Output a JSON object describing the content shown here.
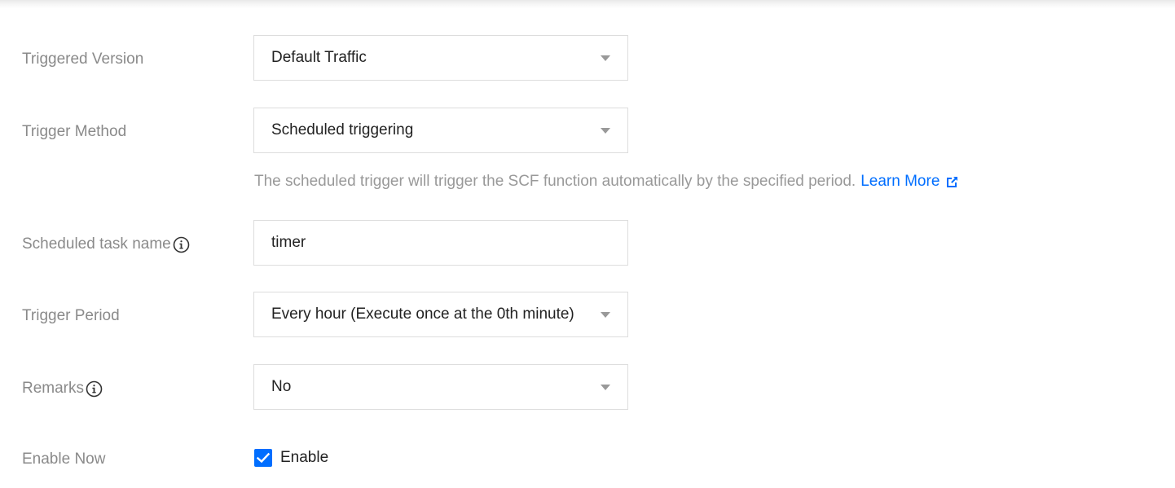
{
  "form": {
    "triggered_version": {
      "label": "Triggered Version",
      "value": "Default Traffic"
    },
    "trigger_method": {
      "label": "Trigger Method",
      "value": "Scheduled triggering",
      "hint": "The scheduled trigger will trigger the SCF function automatically by the specified period.",
      "learn_more": "Learn More"
    },
    "scheduled_task_name": {
      "label": "Scheduled task name",
      "value": "timer"
    },
    "trigger_period": {
      "label": "Trigger Period",
      "value": "Every hour (Execute once at the 0th minute)"
    },
    "remarks": {
      "label": "Remarks",
      "value": "No"
    },
    "enable_now": {
      "label": "Enable Now",
      "checkbox_label": "Enable",
      "checked": true
    }
  },
  "colors": {
    "accent": "#006eff",
    "label_text": "#8a8a8a",
    "hint_text": "#999999",
    "border": "#dddddd"
  },
  "icons": {
    "info": "info-circle-icon",
    "external": "external-link-icon",
    "caret": "caret-down-icon",
    "check": "checkmark-icon"
  }
}
